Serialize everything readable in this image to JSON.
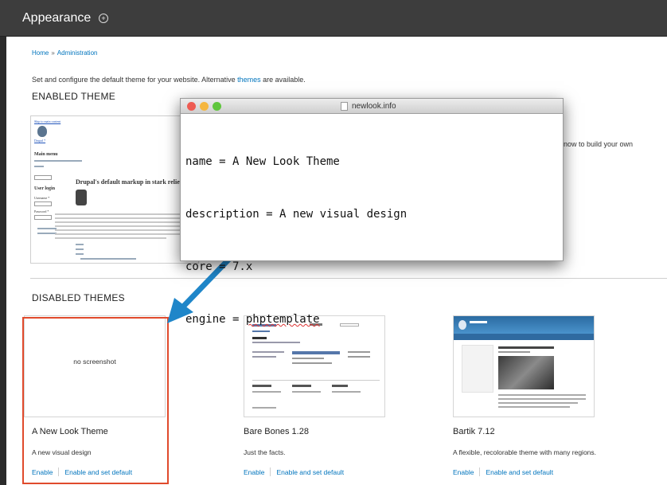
{
  "header": {
    "title": "Appearance",
    "shortcut_icon": "plus-circle-icon"
  },
  "breadcrumb": {
    "items": [
      "Home",
      "Administration"
    ],
    "separator": "»"
  },
  "intro": {
    "before": "Set and configure the default theme for your website. Alternative ",
    "link": "themes",
    "after": " are available."
  },
  "enabled": {
    "title": "ENABLED THEME",
    "preview": {
      "skip_link": "Skip to main content",
      "site_name": "Drupal 7",
      "main_menu": "Main menu",
      "heading": "Drupal's default markup in stark relief",
      "login_title": "User login",
      "username_label": "Username *",
      "password_label": "Password *"
    },
    "side_text": "now to build your own"
  },
  "disabled": {
    "title": "DISABLED THEMES",
    "themes": [
      {
        "name": "A New Look Theme",
        "description": "A new visual design",
        "screenshot_text": "no screenshot",
        "enable": "Enable",
        "enable_default": "Enable and set default"
      },
      {
        "name": "Bare Bones 1.28",
        "description": "Just the facts.",
        "enable": "Enable",
        "enable_default": "Enable and set default"
      },
      {
        "name": "Bartik 7.12",
        "description": "A flexible, recolorable theme with many regions.",
        "enable": "Enable",
        "enable_default": "Enable and set default"
      }
    ]
  },
  "editor": {
    "filename": "newlook.info",
    "lines": [
      "name = A New Look Theme",
      "description = A new visual design",
      "core = 7.x",
      "engine = "
    ],
    "engine_value": "phptemplate",
    "traffic_lights": {
      "close": "#ee5b52",
      "minimize": "#f5b63e",
      "zoom": "#5fc63c"
    }
  },
  "colors": {
    "link": "#0074bd",
    "highlight": "#e04a2c",
    "arrow": "#1f86c9",
    "header": "#3d3d3d"
  }
}
